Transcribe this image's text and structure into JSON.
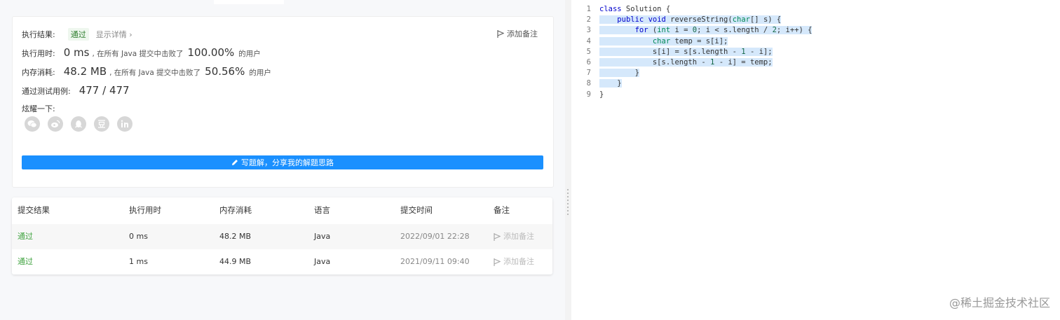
{
  "result": {
    "status_label": "执行结果:",
    "status_value": "通过",
    "details_link": "显示详情 ›",
    "add_note": "添加备注",
    "runtime_label": "执行用时:",
    "runtime_value": "0 ms",
    "runtime_beat_prefix": ", 在所有 Java 提交中击败了",
    "runtime_percent": "100.00%",
    "runtime_suffix": "的用户",
    "memory_label": "内存消耗:",
    "memory_value": "48.2 MB",
    "memory_beat_prefix": ", 在所有 Java 提交中击败了",
    "memory_percent": "50.56%",
    "memory_suffix": "的用户",
    "tests_label": "通过测试用例:",
    "tests_value": "477 / 477",
    "share_label": "炫耀一下:",
    "share_icons": [
      "wechat-icon",
      "weibo-icon",
      "qq-icon",
      "douban-icon",
      "linkedin-icon"
    ],
    "write_button": "写题解，分享我的解题思路"
  },
  "table": {
    "headers": [
      "提交结果",
      "执行用时",
      "内存消耗",
      "语言",
      "提交时间",
      "备注"
    ],
    "rows": [
      {
        "status": "通过",
        "runtime": "0 ms",
        "memory": "48.2 MB",
        "lang": "Java",
        "time": "2022/09/01 22:28",
        "note": "添加备注"
      },
      {
        "status": "通过",
        "runtime": "1 ms",
        "memory": "44.9 MB",
        "lang": "Java",
        "time": "2021/09/11 09:40",
        "note": "添加备注"
      }
    ]
  },
  "editor": {
    "line_numbers": [
      "1",
      "2",
      "3",
      "4",
      "5",
      "6",
      "7",
      "8",
      "9"
    ]
  },
  "watermark": "@稀土掘金技术社区",
  "colors": {
    "accent": "#1a90ff",
    "pass": "#3fa33f",
    "selection": "#d5e8fb"
  }
}
